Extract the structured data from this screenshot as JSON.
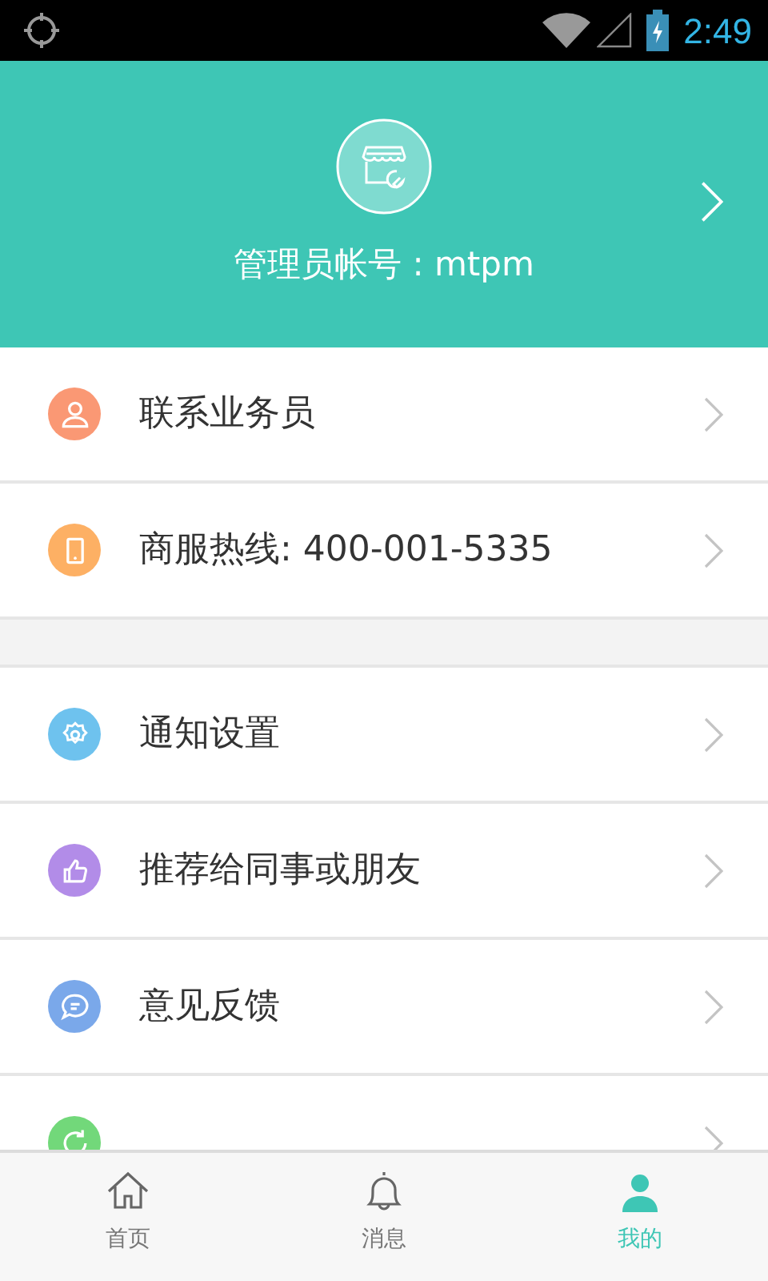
{
  "status_bar": {
    "time": "2:49"
  },
  "header": {
    "account": "管理员帐号 : mtpm"
  },
  "sections": [
    {
      "items": [
        {
          "label": "联系业务员",
          "kind": "person",
          "color": "#fa9874"
        },
        {
          "label": "商服热线: 400-001-5335",
          "kind": "phone",
          "color": "#fdb064"
        }
      ]
    },
    {
      "items": [
        {
          "label": "通知设置",
          "kind": "gear",
          "color": "#6ec2ee"
        },
        {
          "label": "推荐给同事或朋友",
          "kind": "thumb",
          "color": "#b28ce8"
        },
        {
          "label": "意见反馈",
          "kind": "chat",
          "color": "#7aa8ea"
        },
        {
          "kind": "refresh",
          "color": "#72d87a"
        }
      ]
    }
  ],
  "tabs": [
    {
      "label": "首页",
      "kind": "home",
      "selected": false
    },
    {
      "label": "消息",
      "kind": "bell",
      "selected": false
    },
    {
      "label": "我的",
      "kind": "person",
      "selected": true
    }
  ]
}
